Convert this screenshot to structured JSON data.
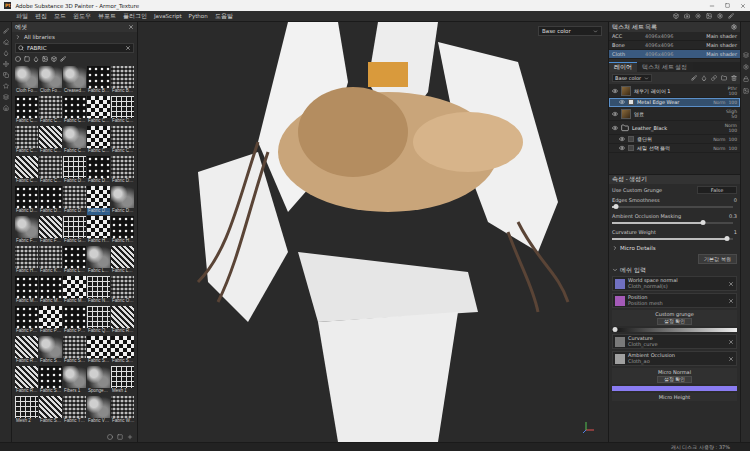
{
  "window": {
    "logo": "Pt",
    "title": "Adobe Substance 3D Painter - Armor_Texture"
  },
  "menu": [
    "파일",
    "편집",
    "모드",
    "윈도우",
    "뷰포트",
    "플러그인",
    "JavaScript",
    "Python",
    "도움말"
  ],
  "assets": {
    "title": "에셋",
    "library": "All libraries",
    "search": "FABRIC",
    "items": [
      {
        "label": "Cloth Fo…",
        "pattern": "noise",
        "selected": false
      },
      {
        "label": "Cloth Fo…",
        "pattern": "noise",
        "selected": false
      },
      {
        "label": "Creased…",
        "pattern": "noise",
        "selected": false
      },
      {
        "label": "Fabric B…",
        "pattern": "dots",
        "selected": false
      },
      {
        "label": "Fabric B…",
        "pattern": "weave",
        "selected": false
      },
      {
        "label": "Fabric C…",
        "pattern": "dots",
        "selected": false
      },
      {
        "label": "Fabric C…",
        "pattern": "weave",
        "selected": false
      },
      {
        "label": "Fabric C…",
        "pattern": "dots",
        "selected": false
      },
      {
        "label": "Fabric C…",
        "pattern": "checker",
        "selected": false
      },
      {
        "label": "Fabric C…",
        "pattern": "grid",
        "selected": false
      },
      {
        "label": "Fabric C…",
        "pattern": "weave",
        "selected": false
      },
      {
        "label": "Fabric C…",
        "pattern": "stripes",
        "selected": false
      },
      {
        "label": "Fabric C…",
        "pattern": "noise",
        "selected": false
      },
      {
        "label": "Fabric C…",
        "pattern": "checker",
        "selected": false
      },
      {
        "label": "Fabric C…",
        "pattern": "weave",
        "selected": false
      },
      {
        "label": "Fabric C…",
        "pattern": "stripes",
        "selected": false
      },
      {
        "label": "Fabric C…",
        "pattern": "weave",
        "selected": false
      },
      {
        "label": "Fabric D…",
        "pattern": "grid",
        "selected": false
      },
      {
        "label": "Fabric D…",
        "pattern": "dots",
        "selected": false
      },
      {
        "label": "Fabric D…",
        "pattern": "weave",
        "selected": false
      },
      {
        "label": "Fabric D…",
        "pattern": "dots",
        "selected": false
      },
      {
        "label": "Fabric D…",
        "pattern": "dots",
        "selected": false
      },
      {
        "label": "Fabric D…",
        "pattern": "weave",
        "selected": false
      },
      {
        "label": "Fabric D…",
        "pattern": "checker",
        "selected": true
      },
      {
        "label": "Fabric D…",
        "pattern": "noise",
        "selected": false
      },
      {
        "label": "Fabric F…",
        "pattern": "noise",
        "selected": false
      },
      {
        "label": "Fabric F…",
        "pattern": "stripes",
        "selected": false
      },
      {
        "label": "Fabric G…",
        "pattern": "grid",
        "selected": false
      },
      {
        "label": "Fabric H…",
        "pattern": "checker",
        "selected": false
      },
      {
        "label": "Fabric H…",
        "pattern": "dots",
        "selected": false
      },
      {
        "label": "Fabric H…",
        "pattern": "weave",
        "selected": false
      },
      {
        "label": "Fabric K…",
        "pattern": "weave",
        "selected": false
      },
      {
        "label": "Fabric L…",
        "pattern": "dots",
        "selected": false
      },
      {
        "label": "Fabric L…",
        "pattern": "noise",
        "selected": false
      },
      {
        "label": "Fabric L…",
        "pattern": "stripes",
        "selected": false
      },
      {
        "label": "Fabric M…",
        "pattern": "dots",
        "selected": false
      },
      {
        "label": "Fabric M…",
        "pattern": "dots",
        "selected": false
      },
      {
        "label": "Fabric M…",
        "pattern": "checker",
        "selected": false
      },
      {
        "label": "Fabric N…",
        "pattern": "grid",
        "selected": false
      },
      {
        "label": "Fabric O…",
        "pattern": "weave",
        "selected": false
      },
      {
        "label": "Fabric P…",
        "pattern": "dots",
        "selected": false
      },
      {
        "label": "Fabric P…",
        "pattern": "checker",
        "selected": false
      },
      {
        "label": "Fabric P…",
        "pattern": "dots",
        "selected": false
      },
      {
        "label": "Fabric Q…",
        "pattern": "grid",
        "selected": false
      },
      {
        "label": "Fabric R…",
        "pattern": "stripes",
        "selected": false
      },
      {
        "label": "Fabric R…",
        "pattern": "stripes",
        "selected": false
      },
      {
        "label": "Fabric S…",
        "pattern": "noise",
        "selected": false
      },
      {
        "label": "Fabric S…",
        "pattern": "weave",
        "selected": false
      },
      {
        "label": "Fabric S…",
        "pattern": "checker",
        "selected": false
      },
      {
        "label": "Fabric S…",
        "pattern": "checker",
        "selected": false
      },
      {
        "label": "Fabric R…",
        "pattern": "stripes",
        "selected": false
      },
      {
        "label": "Fabric S…",
        "pattern": "dots",
        "selected": false
      },
      {
        "label": "Fibers 1",
        "pattern": "noise",
        "selected": false
      },
      {
        "label": "Sponge…",
        "pattern": "noise",
        "selected": false
      },
      {
        "label": "Mesh 1",
        "pattern": "grid",
        "selected": false
      },
      {
        "label": "Mesh 2",
        "pattern": "grid",
        "selected": false
      },
      {
        "label": "Fabric S…",
        "pattern": "stripes",
        "selected": false
      },
      {
        "label": "Fabric T…",
        "pattern": "weave",
        "selected": false
      },
      {
        "label": "Fabric V…",
        "pattern": "noise",
        "selected": false
      },
      {
        "label": "Fabric W…",
        "pattern": "weave",
        "selected": false
      }
    ]
  },
  "viewport": {
    "channel": "Base color"
  },
  "texture_sets": {
    "title": "텍스처 세트 목록",
    "items": [
      {
        "name": "ACC",
        "resolution": "4096x4096",
        "shader": "Main shader",
        "selected": false
      },
      {
        "name": "Bone",
        "resolution": "4096x4096",
        "shader": "Main shader",
        "selected": false
      },
      {
        "name": "Cloth",
        "resolution": "4096x4096",
        "shader": "Main shader",
        "selected": true
      }
    ]
  },
  "layer_tabs": [
    {
      "label": "레이어",
      "selected": true
    },
    {
      "label": "텍스처 세트 설정",
      "selected": false
    }
  ],
  "layer_channel": "Base color",
  "layers": [
    {
      "name": "채우기 레이어 1",
      "blend": "Pthr",
      "opacity": "100",
      "kind": "fill",
      "indent": false,
      "selected": false,
      "visible": true
    },
    {
      "name": "Metal Edge Wear",
      "blend": "Norm",
      "opacity": "100",
      "kind": "generator",
      "indent": true,
      "selected": true,
      "visible": true
    },
    {
      "name": "염료",
      "blend": "Sligh",
      "opacity": "50",
      "kind": "fill",
      "indent": false,
      "selected": false,
      "visible": true
    },
    {
      "name": "Leather_Black",
      "blend": "Norm",
      "opacity": "100",
      "kind": "folder",
      "indent": false,
      "selected": false,
      "visible": true
    },
    {
      "name": "용단위",
      "blend": "Norm",
      "opacity": "100",
      "kind": "effect",
      "indent": true,
      "selected": false,
      "visible": true
    },
    {
      "name": "세밀 선택 플럭",
      "blend": "Norm",
      "opacity": "100",
      "kind": "effect",
      "indent": true,
      "selected": false,
      "visible": true
    }
  ],
  "properties": {
    "title": "속성 - 생성기",
    "params": [
      {
        "kind": "value",
        "label": "Use Custom Grunge",
        "value": "False"
      },
      {
        "kind": "slider",
        "label": "Edges Smoothness",
        "value": "0",
        "level": 0.03
      },
      {
        "kind": "slider",
        "label": "Ambient Occlusion Masking",
        "value": "0.3",
        "level": 0.75
      },
      {
        "kind": "slider",
        "label": "Curvature Weight",
        "value": "1",
        "level": 0.95
      }
    ],
    "micro_details": {
      "label": "Micro Details",
      "expanded": false
    },
    "reset": "기본값 복원",
    "mesh_inputs": {
      "label": "메쉬 입력",
      "expanded": true,
      "items": [
        {
          "kind": "map",
          "label": "World space normal",
          "value": "Cloth_normal(s)",
          "color": "#7070c0"
        },
        {
          "kind": "map",
          "label": "Position",
          "value": "Position mesh",
          "color": "#a45ab8"
        },
        {
          "kind": "slot",
          "label": "Custom grunge",
          "button": "설정 확인"
        },
        {
          "kind": "slider",
          "level": 0.02
        },
        {
          "kind": "map",
          "label": "Curvature",
          "value": "Cloth_curve",
          "color": "#7a7a7a"
        },
        {
          "kind": "map",
          "label": "Ambient Occlusion",
          "value": "Cloth_ao",
          "color": "#a0a0a0"
        },
        {
          "kind": "slot",
          "label": "Micro Normal",
          "button": "설정 확인"
        },
        {
          "kind": "swatch",
          "color": "#8a7cf2"
        },
        {
          "kind": "header",
          "label": "Micro Height"
        }
      ]
    }
  },
  "status_bar": "캐시 디스크 사용량 : 37%"
}
